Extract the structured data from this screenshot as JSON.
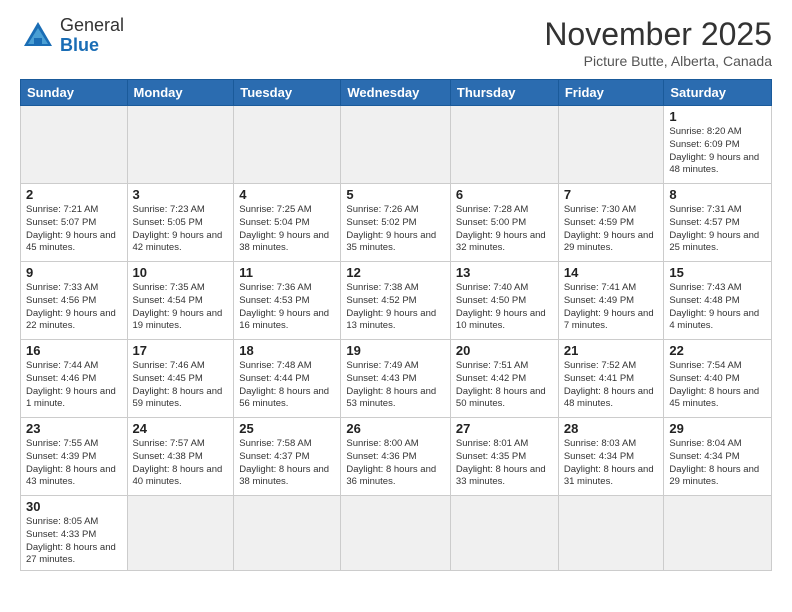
{
  "logo": {
    "line1": "General",
    "line2": "Blue"
  },
  "title": "November 2025",
  "location": "Picture Butte, Alberta, Canada",
  "days_of_week": [
    "Sunday",
    "Monday",
    "Tuesday",
    "Wednesday",
    "Thursday",
    "Friday",
    "Saturday"
  ],
  "weeks": [
    [
      {
        "day": "",
        "info": ""
      },
      {
        "day": "",
        "info": ""
      },
      {
        "day": "",
        "info": ""
      },
      {
        "day": "",
        "info": ""
      },
      {
        "day": "",
        "info": ""
      },
      {
        "day": "",
        "info": ""
      },
      {
        "day": "1",
        "info": "Sunrise: 8:20 AM\nSunset: 6:09 PM\nDaylight: 9 hours\nand 48 minutes."
      }
    ],
    [
      {
        "day": "2",
        "info": "Sunrise: 7:21 AM\nSunset: 5:07 PM\nDaylight: 9 hours\nand 45 minutes."
      },
      {
        "day": "3",
        "info": "Sunrise: 7:23 AM\nSunset: 5:05 PM\nDaylight: 9 hours\nand 42 minutes."
      },
      {
        "day": "4",
        "info": "Sunrise: 7:25 AM\nSunset: 5:04 PM\nDaylight: 9 hours\nand 38 minutes."
      },
      {
        "day": "5",
        "info": "Sunrise: 7:26 AM\nSunset: 5:02 PM\nDaylight: 9 hours\nand 35 minutes."
      },
      {
        "day": "6",
        "info": "Sunrise: 7:28 AM\nSunset: 5:00 PM\nDaylight: 9 hours\nand 32 minutes."
      },
      {
        "day": "7",
        "info": "Sunrise: 7:30 AM\nSunset: 4:59 PM\nDaylight: 9 hours\nand 29 minutes."
      },
      {
        "day": "8",
        "info": "Sunrise: 7:31 AM\nSunset: 4:57 PM\nDaylight: 9 hours\nand 25 minutes."
      }
    ],
    [
      {
        "day": "9",
        "info": "Sunrise: 7:33 AM\nSunset: 4:56 PM\nDaylight: 9 hours\nand 22 minutes."
      },
      {
        "day": "10",
        "info": "Sunrise: 7:35 AM\nSunset: 4:54 PM\nDaylight: 9 hours\nand 19 minutes."
      },
      {
        "day": "11",
        "info": "Sunrise: 7:36 AM\nSunset: 4:53 PM\nDaylight: 9 hours\nand 16 minutes."
      },
      {
        "day": "12",
        "info": "Sunrise: 7:38 AM\nSunset: 4:52 PM\nDaylight: 9 hours\nand 13 minutes."
      },
      {
        "day": "13",
        "info": "Sunrise: 7:40 AM\nSunset: 4:50 PM\nDaylight: 9 hours\nand 10 minutes."
      },
      {
        "day": "14",
        "info": "Sunrise: 7:41 AM\nSunset: 4:49 PM\nDaylight: 9 hours\nand 7 minutes."
      },
      {
        "day": "15",
        "info": "Sunrise: 7:43 AM\nSunset: 4:48 PM\nDaylight: 9 hours\nand 4 minutes."
      }
    ],
    [
      {
        "day": "16",
        "info": "Sunrise: 7:44 AM\nSunset: 4:46 PM\nDaylight: 9 hours\nand 1 minute."
      },
      {
        "day": "17",
        "info": "Sunrise: 7:46 AM\nSunset: 4:45 PM\nDaylight: 8 hours\nand 59 minutes."
      },
      {
        "day": "18",
        "info": "Sunrise: 7:48 AM\nSunset: 4:44 PM\nDaylight: 8 hours\nand 56 minutes."
      },
      {
        "day": "19",
        "info": "Sunrise: 7:49 AM\nSunset: 4:43 PM\nDaylight: 8 hours\nand 53 minutes."
      },
      {
        "day": "20",
        "info": "Sunrise: 7:51 AM\nSunset: 4:42 PM\nDaylight: 8 hours\nand 50 minutes."
      },
      {
        "day": "21",
        "info": "Sunrise: 7:52 AM\nSunset: 4:41 PM\nDaylight: 8 hours\nand 48 minutes."
      },
      {
        "day": "22",
        "info": "Sunrise: 7:54 AM\nSunset: 4:40 PM\nDaylight: 8 hours\nand 45 minutes."
      }
    ],
    [
      {
        "day": "23",
        "info": "Sunrise: 7:55 AM\nSunset: 4:39 PM\nDaylight: 8 hours\nand 43 minutes."
      },
      {
        "day": "24",
        "info": "Sunrise: 7:57 AM\nSunset: 4:38 PM\nDaylight: 8 hours\nand 40 minutes."
      },
      {
        "day": "25",
        "info": "Sunrise: 7:58 AM\nSunset: 4:37 PM\nDaylight: 8 hours\nand 38 minutes."
      },
      {
        "day": "26",
        "info": "Sunrise: 8:00 AM\nSunset: 4:36 PM\nDaylight: 8 hours\nand 36 minutes."
      },
      {
        "day": "27",
        "info": "Sunrise: 8:01 AM\nSunset: 4:35 PM\nDaylight: 8 hours\nand 33 minutes."
      },
      {
        "day": "28",
        "info": "Sunrise: 8:03 AM\nSunset: 4:34 PM\nDaylight: 8 hours\nand 31 minutes."
      },
      {
        "day": "29",
        "info": "Sunrise: 8:04 AM\nSunset: 4:34 PM\nDaylight: 8 hours\nand 29 minutes."
      }
    ],
    [
      {
        "day": "30",
        "info": "Sunrise: 8:05 AM\nSunset: 4:33 PM\nDaylight: 8 hours\nand 27 minutes."
      },
      {
        "day": "",
        "info": ""
      },
      {
        "day": "",
        "info": ""
      },
      {
        "day": "",
        "info": ""
      },
      {
        "day": "",
        "info": ""
      },
      {
        "day": "",
        "info": ""
      },
      {
        "day": "",
        "info": ""
      }
    ]
  ]
}
